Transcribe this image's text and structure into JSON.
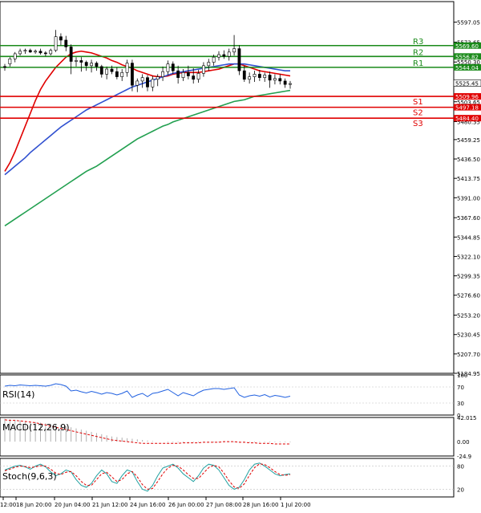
{
  "chart_data": {
    "type": "line",
    "chart_kind": "candlestick",
    "y_range": [
      5184.95,
      5608
    ],
    "price_ticks": [
      "5597.05",
      "5573.65",
      "5550.30",
      "5527.00",
      "5503.65",
      "5480.35",
      "5459.25",
      "5436.50",
      "5413.75",
      "5391.00",
      "5367.60",
      "5344.85",
      "5322.10",
      "5299.35",
      "5276.60",
      "5253.20",
      "5230.45",
      "5207.70",
      "5184.95"
    ],
    "levels": [
      {
        "name": "R3",
        "value": 5569.6,
        "label": "5569.60",
        "color": "#1a8a1a"
      },
      {
        "name": "R2",
        "value": 5556.82,
        "label": "5556.82",
        "color": "#1a8a1a"
      },
      {
        "name": "R1",
        "value": 5544.04,
        "label": "5544.04",
        "color": "#1a8a1a"
      },
      {
        "name": "S1",
        "value": 5509.96,
        "label": "5509.96",
        "color": "#e00000"
      },
      {
        "name": "S2",
        "value": 5497.18,
        "label": "5497.18",
        "color": "#e00000"
      },
      {
        "name": "S3",
        "value": 5484.4,
        "label": "5484.40",
        "color": "#e00000"
      }
    ],
    "current_price": "5525.45",
    "x_labels": [
      "12:00",
      "18 Jun 20:00",
      "20 Jun 04:00",
      "21 Jun 12:00",
      "24 Jun 16:00",
      "26 Jun 00:00",
      "27 Jun 08:00",
      "28 Jun 16:00",
      "1 Jul 20:00"
    ],
    "candles_ohlc": [
      [
        5545,
        5548,
        5540,
        5544
      ],
      [
        5548,
        5556,
        5545,
        5554
      ],
      [
        5554,
        5562,
        5550,
        5560
      ],
      [
        5560,
        5566,
        5558,
        5563
      ],
      [
        5563,
        5566,
        5560,
        5564
      ],
      [
        5564,
        5566,
        5561,
        5562
      ],
      [
        5562,
        5565,
        5560,
        5563
      ],
      [
        5563,
        5566,
        5559,
        5561
      ],
      [
        5561,
        5563,
        5557,
        5560
      ],
      [
        5560,
        5566,
        5558,
        5564
      ],
      [
        5564,
        5588,
        5562,
        5580
      ],
      [
        5580,
        5584,
        5570,
        5576
      ],
      [
        5576,
        5581,
        5563,
        5568
      ],
      [
        5568,
        5571,
        5536,
        5551
      ],
      [
        5551,
        5556,
        5545,
        5552
      ],
      [
        5552,
        5556,
        5539,
        5550
      ],
      [
        5550,
        5552,
        5540,
        5546
      ],
      [
        5546,
        5553,
        5538,
        5549
      ],
      [
        5549,
        5551,
        5540,
        5545
      ],
      [
        5545,
        5547,
        5532,
        5536
      ],
      [
        5536,
        5545,
        5530,
        5542
      ],
      [
        5542,
        5546,
        5536,
        5539
      ],
      [
        5539,
        5544,
        5530,
        5533
      ],
      [
        5533,
        5542,
        5528,
        5538
      ],
      [
        5538,
        5553,
        5533,
        5549
      ],
      [
        5549,
        5553,
        5516,
        5523
      ],
      [
        5523,
        5531,
        5515,
        5528
      ],
      [
        5528,
        5536,
        5520,
        5532
      ],
      [
        5532,
        5535,
        5516,
        5521
      ],
      [
        5521,
        5534,
        5516,
        5530
      ],
      [
        5530,
        5536,
        5522,
        5533
      ],
      [
        5533,
        5545,
        5528,
        5539
      ],
      [
        5539,
        5552,
        5535,
        5548
      ],
      [
        5548,
        5551,
        5536,
        5540
      ],
      [
        5540,
        5546,
        5525,
        5532
      ],
      [
        5532,
        5542,
        5528,
        5538
      ],
      [
        5538,
        5546,
        5530,
        5534
      ],
      [
        5534,
        5543,
        5525,
        5530
      ],
      [
        5530,
        5541,
        5526,
        5537
      ],
      [
        5537,
        5550,
        5533,
        5546
      ],
      [
        5546,
        5554,
        5540,
        5550
      ],
      [
        5550,
        5559,
        5546,
        5556
      ],
      [
        5556,
        5563,
        5552,
        5559
      ],
      [
        5559,
        5564,
        5554,
        5557
      ],
      [
        5557,
        5566,
        5552,
        5562
      ],
      [
        5562,
        5582,
        5558,
        5566
      ],
      [
        5566,
        5570,
        5535,
        5540
      ],
      [
        5540,
        5546,
        5527,
        5530
      ],
      [
        5530,
        5538,
        5525,
        5533
      ],
      [
        5533,
        5540,
        5527,
        5536
      ],
      [
        5536,
        5541,
        5528,
        5532
      ],
      [
        5532,
        5538,
        5527,
        5535
      ],
      [
        5535,
        5539,
        5520,
        5529
      ],
      [
        5529,
        5536,
        5524,
        5531
      ],
      [
        5531,
        5536,
        5524,
        5528
      ],
      [
        5528,
        5531,
        5520,
        5524
      ],
      [
        5524,
        5528,
        5519,
        5525
      ]
    ],
    "ma_lines": [
      {
        "color": "#e00000",
        "values": [
          5422,
          5432,
          5445,
          5460,
          5475,
          5490,
          5505,
          5518,
          5528,
          5536,
          5544,
          5550,
          5556,
          5560,
          5562,
          5563,
          5562,
          5561,
          5559,
          5557,
          5555,
          5552,
          5550,
          5547,
          5545,
          5543,
          5540,
          5538,
          5536,
          5534,
          5533,
          5533,
          5534,
          5536,
          5537,
          5538,
          5538,
          5538,
          5538,
          5539,
          5540,
          5541,
          5542,
          5544,
          5546,
          5548,
          5548,
          5546,
          5544,
          5542,
          5540,
          5539,
          5538,
          5537,
          5536,
          5535,
          5534
        ]
      },
      {
        "color": "#3050d0",
        "values": [
          5418,
          5423,
          5428,
          5433,
          5438,
          5444,
          5449,
          5454,
          5459,
          5464,
          5469,
          5474,
          5478,
          5482,
          5486,
          5490,
          5494,
          5497,
          5500,
          5503,
          5506,
          5509,
          5512,
          5515,
          5518,
          5521,
          5523,
          5525,
          5527,
          5529,
          5531,
          5533,
          5535,
          5537,
          5538,
          5539,
          5540,
          5541,
          5542,
          5543,
          5544,
          5545,
          5546,
          5547,
          5548,
          5548,
          5548,
          5548,
          5547,
          5546,
          5545,
          5544,
          5543,
          5542,
          5541,
          5540,
          5540
        ]
      },
      {
        "color": "#22a050",
        "values": [
          5358,
          5362,
          5366,
          5370,
          5374,
          5378,
          5382,
          5386,
          5390,
          5394,
          5398,
          5402,
          5406,
          5410,
          5414,
          5418,
          5422,
          5425,
          5428,
          5432,
          5436,
          5440,
          5444,
          5448,
          5452,
          5456,
          5460,
          5463,
          5466,
          5469,
          5472,
          5475,
          5477,
          5480,
          5482,
          5484,
          5486,
          5488,
          5490,
          5492,
          5494,
          5496,
          5498,
          5500,
          5502,
          5504,
          5505,
          5506,
          5508,
          5510,
          5511,
          5512,
          5513,
          5514,
          5515,
          5516,
          5517
        ]
      }
    ],
    "indicators": [
      {
        "name": "RSI(14)",
        "ticks": [
          "100",
          "70",
          "30",
          "0"
        ],
        "range": [
          0,
          100
        ],
        "values": [
          72,
          74,
          73,
          75,
          74,
          73,
          74,
          73,
          72,
          74,
          78,
          76,
          72,
          60,
          62,
          58,
          55,
          59,
          56,
          52,
          56,
          54,
          50,
          54,
          60,
          44,
          50,
          54,
          46,
          54,
          56,
          60,
          64,
          56,
          48,
          56,
          52,
          48,
          56,
          62,
          64,
          66,
          66,
          64,
          66,
          68,
          50,
          44,
          48,
          50,
          47,
          51,
          45,
          49,
          47,
          44,
          47
        ]
      },
      {
        "name": "MACD(12,26,9)",
        "ticks": [
          "42.015",
          "0.00",
          "-24.9"
        ],
        "range": [
          -24.9,
          42.015
        ],
        "histogram": [
          40,
          39,
          38,
          37,
          36,
          35,
          34,
          33,
          32,
          31,
          30,
          29,
          27,
          25,
          23,
          21,
          19,
          17,
          15,
          13,
          11,
          9,
          8,
          7,
          6,
          5,
          4,
          3,
          2,
          1,
          0,
          0,
          -1,
          -1,
          -1,
          -1,
          -1,
          -1,
          -1,
          -1,
          -1,
          -1,
          -1,
          -1,
          -1,
          -1,
          -1,
          -1,
          -1,
          -1,
          -1,
          -1,
          -1,
          -1,
          -1,
          -1,
          -1
        ],
        "signal": [
          38,
          37,
          37,
          36,
          35,
          34,
          33,
          31,
          29,
          27,
          25,
          23,
          21,
          19,
          17,
          15,
          13,
          11,
          9,
          7,
          5,
          3,
          2,
          1,
          0,
          -1,
          -2,
          -3,
          -3,
          -3,
          -3,
          -3,
          -3,
          -3,
          -3,
          -2,
          -2,
          -2,
          -2,
          -1,
          -1,
          -1,
          -1,
          0,
          0,
          0,
          -1,
          -1,
          -2,
          -2,
          -3,
          -3,
          -3,
          -4,
          -4,
          -4,
          -4
        ]
      },
      {
        "name": "Stoch(9,6,3)",
        "ticks": [
          "80",
          "20"
        ],
        "range": [
          0,
          100
        ],
        "k": [
          70,
          75,
          80,
          82,
          78,
          72,
          80,
          85,
          78,
          65,
          55,
          60,
          70,
          65,
          45,
          30,
          25,
          35,
          55,
          70,
          60,
          40,
          35,
          55,
          70,
          65,
          40,
          20,
          15,
          30,
          55,
          75,
          80,
          85,
          75,
          60,
          50,
          40,
          55,
          75,
          85,
          82,
          70,
          50,
          30,
          20,
          25,
          45,
          70,
          85,
          88,
          80,
          70,
          60,
          55,
          58,
          60
        ],
        "d": [
          68,
          72,
          77,
          80,
          79,
          76,
          78,
          81,
          80,
          72,
          62,
          58,
          64,
          66,
          55,
          40,
          30,
          30,
          45,
          60,
          64,
          52,
          40,
          45,
          60,
          66,
          52,
          32,
          20,
          22,
          40,
          60,
          75,
          82,
          80,
          70,
          58,
          48,
          48,
          62,
          76,
          82,
          78,
          62,
          42,
          26,
          22,
          34,
          56,
          76,
          86,
          84,
          76,
          66,
          58,
          56,
          58
        ]
      }
    ]
  }
}
